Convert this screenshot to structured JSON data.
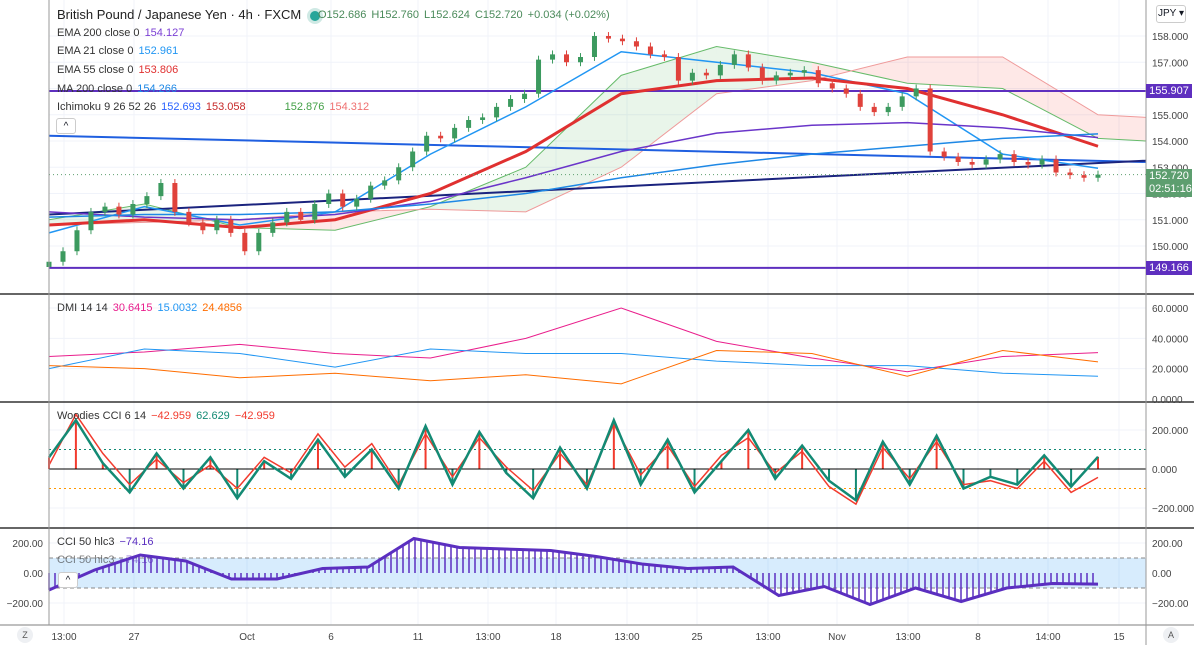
{
  "header": {
    "title": "British Pound / Japanese Yen · 4h · FXCM",
    "open": "O152.686",
    "high": "H152.760",
    "low": "L152.624",
    "close": "C152.720",
    "change": "+0.034 (+0.02%)",
    "currency": "JPY"
  },
  "legends": {
    "ema200": {
      "label": "EMA 200 close 0",
      "value": "154.127",
      "color": "#7b3fd4"
    },
    "ema21": {
      "label": "EMA 21 close 0",
      "value": "152.961",
      "color": "#2196f3"
    },
    "ema55": {
      "label": "EMA 55 close 0",
      "value": "153.806",
      "color": "#e03030"
    },
    "ma200": {
      "label": "MA 200 close 0",
      "value": "154.266",
      "color": "#1e88e5"
    },
    "ichimoku": {
      "label": "Ichimoku 9 26 52 26",
      "v1": "152.693",
      "v2": "153.058",
      "v3": "152.876",
      "v4": "154.312"
    },
    "dmi": {
      "label": "DMI 14 14",
      "v1": "30.6415",
      "v2": "15.0032",
      "v3": "24.4856"
    },
    "woodies": {
      "label": "Woodies CCI 6 14",
      "v1": "−42.959",
      "v2": "62.629",
      "v3": "−42.959"
    },
    "cci50a": {
      "label": "CCI 50 hlc3",
      "value": "−74.16"
    },
    "cci50b": {
      "label": "CCI 50 hlc3",
      "value": "−74.16"
    }
  },
  "price_labels": {
    "upper_line": "155.907",
    "lower_line": "149.166",
    "last": "152.720",
    "countdown": "02:51:16"
  },
  "buttons": {
    "collapse": "^",
    "z": "Z",
    "a": "A"
  },
  "chart_data": [
    {
      "type": "candlestick",
      "title": "British Pound / Japanese Yen · 4h · FXCM",
      "ylim": [
        149,
        158.5
      ],
      "yticks": [
        "158.000",
        "157.000",
        "155.000",
        "154.000",
        "153.000",
        "152.000",
        "151.000",
        "150.000"
      ],
      "xticks": [
        "13:00",
        "27",
        "Oct",
        "6",
        "11",
        "13:00",
        "18",
        "13:00",
        "25",
        "13:00",
        "Nov",
        "13:00",
        "8",
        "14:00",
        "15"
      ],
      "closes": [
        149.4,
        149.8,
        150.6,
        151.3,
        151.5,
        151.2,
        151.6,
        151.9,
        152.4,
        151.3,
        150.9,
        150.6,
        151.0,
        150.5,
        149.8,
        150.5,
        150.9,
        151.3,
        151.0,
        151.6,
        152.0,
        151.5,
        151.8,
        152.3,
        152.5,
        153.0,
        153.6,
        154.2,
        154.1,
        154.5,
        154.8,
        154.9,
        155.3,
        155.6,
        155.8,
        157.1,
        157.3,
        157.0,
        157.2,
        158.0,
        157.9,
        157.8,
        157.6,
        157.3,
        157.2,
        156.3,
        156.6,
        156.5,
        156.9,
        157.3,
        156.8,
        156.3,
        156.5,
        156.6,
        156.7,
        156.2,
        156.0,
        155.8,
        155.3,
        155.1,
        155.3,
        155.7,
        156.0,
        153.6,
        153.4,
        153.2,
        153.1,
        153.3,
        153.5,
        153.2,
        153.1,
        153.3,
        152.8,
        152.7,
        152.6,
        152.72
      ],
      "series": [
        {
          "name": "EMA 21",
          "color": "#2196f3",
          "values": [
            150.5,
            151.5,
            150.8,
            151.3,
            153.5,
            155.3,
            157.4,
            157.0,
            156.6,
            155.8,
            153.5,
            152.96
          ]
        },
        {
          "name": "EMA 55",
          "color": "#e03030",
          "values": [
            150.8,
            151.0,
            150.7,
            151.0,
            152.0,
            153.6,
            155.8,
            156.3,
            156.4,
            156.0,
            155.0,
            153.8
          ]
        },
        {
          "name": "EMA 200",
          "color": "#6a35c9",
          "values": [
            151.3,
            151.1,
            151.0,
            151.2,
            151.7,
            152.6,
            153.6,
            154.3,
            154.6,
            154.7,
            154.5,
            154.13
          ]
        },
        {
          "name": "MA 200",
          "color": "#1e88e5",
          "values": [
            151.1,
            151.2,
            151.2,
            151.3,
            151.6,
            152.0,
            152.6,
            153.1,
            153.5,
            153.8,
            154.1,
            154.27
          ]
        }
      ],
      "cloud": {
        "span_a": [
          151.0,
          151.6,
          150.7,
          150.6,
          151.5,
          153.0,
          156.5,
          157.6,
          157.0,
          156.2,
          156.0,
          154.1,
          154.0
        ],
        "span_b": [
          150.8,
          150.9,
          151.0,
          151.3,
          151.4,
          151.3,
          153.0,
          155.8,
          156.3,
          157.2,
          157.2,
          155.0,
          154.9
        ]
      },
      "horizontal_lines": [
        155.907,
        149.166
      ],
      "trendlines": [
        {
          "from": 154.2,
          "to": 153.2,
          "color": "#1f5fe0"
        },
        {
          "from": 151.2,
          "to": 153.25,
          "color": "#1a237e"
        }
      ]
    },
    {
      "type": "line",
      "title": "DMI 14 14",
      "ylim": [
        0,
        60
      ],
      "yticks": [
        "60.0000",
        "40.0000",
        "20.0000",
        "0.0000"
      ],
      "series": [
        {
          "color": "#e91e8c",
          "values": [
            28,
            31,
            36,
            30,
            27,
            40,
            60,
            38,
            27,
            18,
            28,
            30.6
          ]
        },
        {
          "color": "#2196f3",
          "values": [
            20,
            33,
            30,
            21,
            33,
            30,
            30,
            25,
            22,
            22,
            17,
            15
          ]
        },
        {
          "color": "#ff6d00",
          "values": [
            22,
            20,
            14,
            17,
            12,
            16,
            10,
            32,
            30,
            15,
            32,
            24.5
          ]
        }
      ]
    },
    {
      "type": "line",
      "title": "Woodies CCI 6 14",
      "ylim": [
        -250,
        250
      ],
      "yticks": [
        "200.000",
        "0.000",
        "−200.000"
      ],
      "levels": [
        100,
        0,
        -100
      ],
      "series": [
        {
          "color": "#138a74",
          "values": [
            60,
            250,
            30,
            -120,
            80,
            -100,
            60,
            -150,
            40,
            -50,
            150,
            -40,
            100,
            -100,
            220,
            -80,
            190,
            -20,
            -150,
            110,
            -100,
            250,
            -80,
            150,
            -120,
            40,
            200,
            -50,
            120,
            -60,
            -160,
            140,
            -80,
            170,
            -100,
            -40,
            -80,
            70,
            -90,
            62.6
          ]
        },
        {
          "color": "#f23b2e",
          "values": [
            20,
            280,
            80,
            -80,
            50,
            -70,
            20,
            -100,
            60,
            -20,
            180,
            10,
            130,
            -80,
            180,
            -40,
            160,
            10,
            -110,
            80,
            -80,
            230,
            -30,
            120,
            -90,
            70,
            160,
            -20,
            90,
            -90,
            -180,
            110,
            -50,
            140,
            -80,
            -60,
            -100,
            40,
            -120,
            -43
          ]
        }
      ]
    },
    {
      "type": "line",
      "title": "CCI 50 hlc3",
      "ylim": [
        -300,
        300
      ],
      "yticks": [
        "200.00",
        "0.00",
        "−200.00"
      ],
      "band": [
        -100,
        100
      ],
      "series": [
        {
          "color": "#5b2fc0",
          "values": [
            -113,
            20,
            120,
            80,
            -40,
            -40,
            30,
            40,
            230,
            170,
            160,
            150,
            110,
            60,
            30,
            40,
            -150,
            -90,
            -210,
            -100,
            -190,
            -100,
            -70,
            -74
          ]
        }
      ]
    }
  ]
}
